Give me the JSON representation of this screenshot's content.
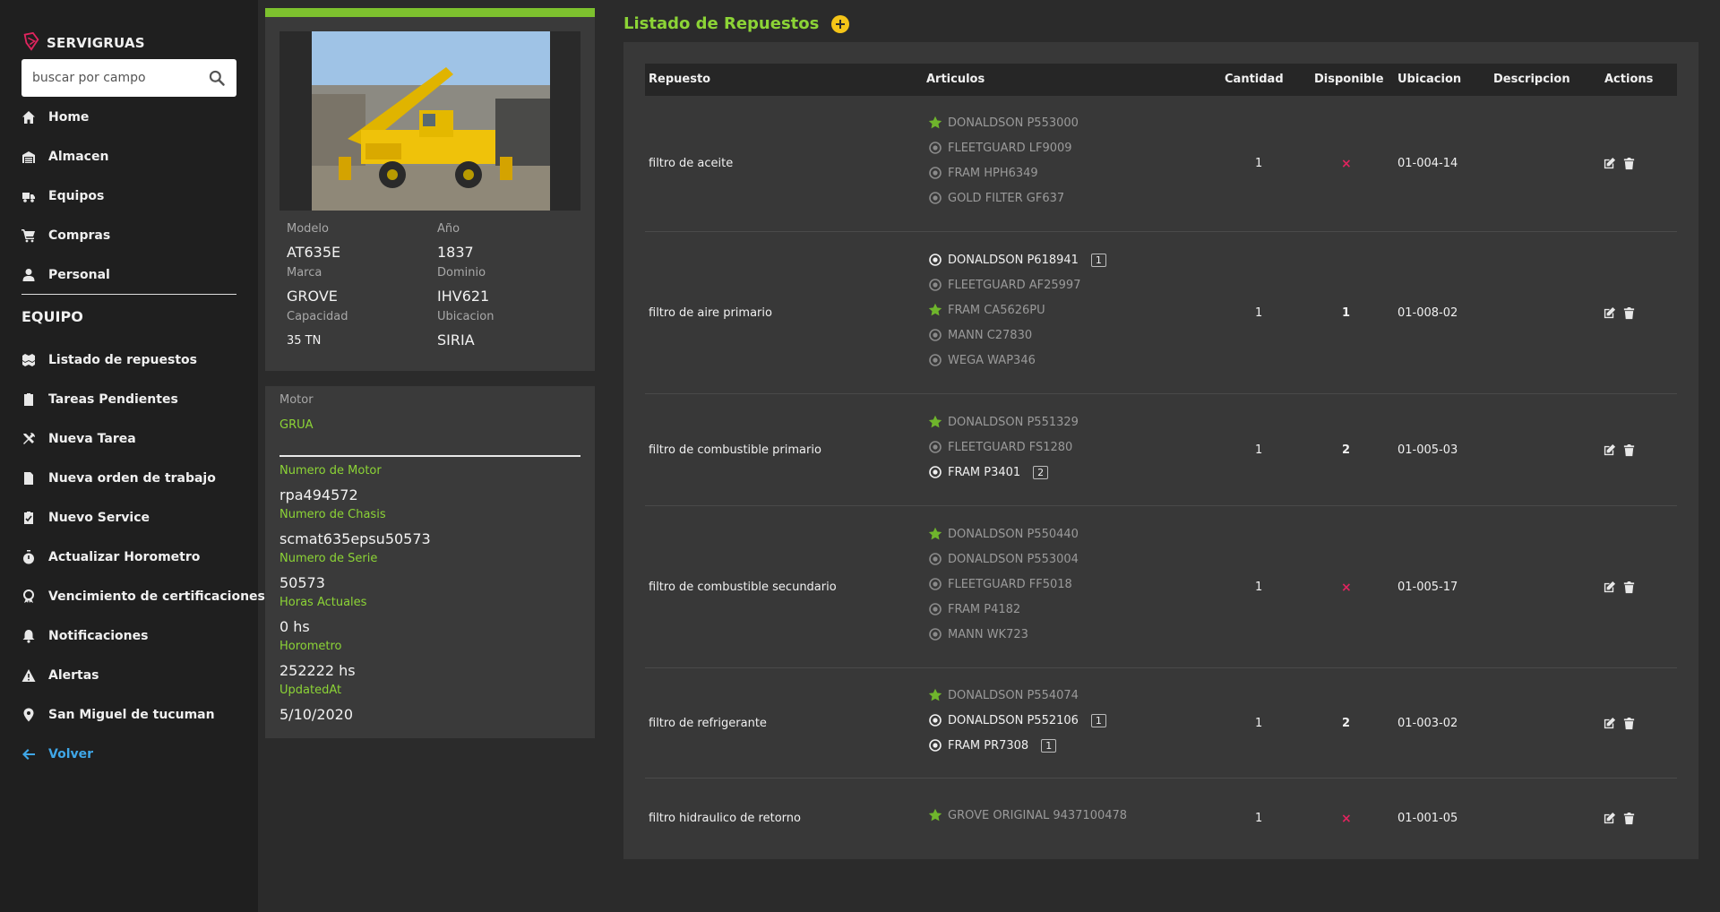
{
  "brand": {
    "name": "SERVIGRUAS"
  },
  "search": {
    "placeholder": "buscar por campo"
  },
  "nav_main": [
    {
      "label": "Home",
      "icon": "home-icon"
    },
    {
      "label": "Almacen",
      "icon": "warehouse-icon"
    },
    {
      "label": "Equipos",
      "icon": "truck-icon"
    },
    {
      "label": "Compras",
      "icon": "cart-icon"
    },
    {
      "label": "Personal",
      "icon": "user-icon"
    }
  ],
  "section_title": "EQUIPO",
  "nav_equipo": [
    {
      "label": "Listado de repuestos",
      "icon": "cubes-icon"
    },
    {
      "label": "Tareas Pendientes",
      "icon": "clipboard-icon"
    },
    {
      "label": "Nueva Tarea",
      "icon": "tools-icon"
    },
    {
      "label": "Nueva orden de trabajo",
      "icon": "file-icon"
    },
    {
      "label": "Nuevo Service",
      "icon": "clipboard-check-icon"
    },
    {
      "label": "Actualizar Horometro",
      "icon": "stopwatch-icon"
    },
    {
      "label": "Vencimiento de certificaciones",
      "icon": "award-icon"
    },
    {
      "label": "Notificaciones",
      "icon": "bell-icon"
    },
    {
      "label": "Alertas",
      "icon": "warning-icon"
    },
    {
      "label": "San Miguel de tucuman",
      "icon": "map-marker-icon"
    },
    {
      "label": "Volver",
      "icon": "arrow-left-icon"
    }
  ],
  "equipo": {
    "modelo_label": "Modelo",
    "modelo": "AT635E",
    "anio_label": "Año",
    "anio": "1837",
    "marca_label": "Marca",
    "marca": "GROVE",
    "dominio_label": "Dominio",
    "dominio": "IHV621",
    "capacidad_label": "Capacidad",
    "capacidad": "35 TN",
    "ubicacion_label": "Ubicacion",
    "ubicacion": "SIRIA"
  },
  "motor": {
    "label": "Motor",
    "tipo": "GRUA",
    "numero_motor_label": "Numero de Motor",
    "numero_motor": "rpa494572",
    "numero_chasis_label": "Numero de Chasis",
    "numero_chasis": "scmat635epsu50573",
    "numero_serie_label": "Numero de Serie",
    "numero_serie": "50573",
    "horas_label": "Horas Actuales",
    "horas": "0 hs",
    "horometro_label": "Horometro",
    "horometro": "252222 hs",
    "updated_label": "UpdatedAt",
    "updated": "5/10/2020"
  },
  "list": {
    "title": "Listado de Repuestos",
    "headers": [
      "Repuesto",
      "Articulos",
      "Cantidad",
      "Disponible",
      "Ubicacion",
      "Descripcion",
      "Actions"
    ],
    "rows": [
      {
        "repuesto": "filtro de aceite",
        "cantidad": "1",
        "disponible": "×",
        "ubicacion": "01-004-14",
        "descripcion": "",
        "articulos": [
          {
            "name": "DONALDSON P553000",
            "icon": "star-icon",
            "active": false,
            "badge": ""
          },
          {
            "name": "FLEETGUARD LF9009",
            "icon": "radio-icon",
            "active": false,
            "badge": ""
          },
          {
            "name": "FRAM HPH6349",
            "icon": "radio-icon",
            "active": false,
            "badge": ""
          },
          {
            "name": "GOLD FILTER GF637",
            "icon": "radio-icon",
            "active": false,
            "badge": ""
          }
        ]
      },
      {
        "repuesto": "filtro de aire primario",
        "cantidad": "1",
        "disponible": "1",
        "ubicacion": "01-008-02",
        "descripcion": "",
        "articulos": [
          {
            "name": "DONALDSON P618941",
            "icon": "radio-icon",
            "active": true,
            "badge": "1"
          },
          {
            "name": "FLEETGUARD AF25997",
            "icon": "radio-icon",
            "active": false,
            "badge": ""
          },
          {
            "name": "FRAM CA5626PU",
            "icon": "star-icon",
            "active": false,
            "badge": ""
          },
          {
            "name": "MANN C27830",
            "icon": "radio-icon",
            "active": false,
            "badge": ""
          },
          {
            "name": "WEGA WAP346",
            "icon": "radio-icon",
            "active": false,
            "badge": ""
          }
        ]
      },
      {
        "repuesto": "filtro de combustible primario",
        "cantidad": "1",
        "disponible": "2",
        "ubicacion": "01-005-03",
        "descripcion": "",
        "articulos": [
          {
            "name": "DONALDSON P551329",
            "icon": "star-icon",
            "active": false,
            "badge": ""
          },
          {
            "name": "FLEETGUARD FS1280",
            "icon": "radio-icon",
            "active": false,
            "badge": ""
          },
          {
            "name": "FRAM P3401",
            "icon": "radio-icon",
            "active": true,
            "badge": "2"
          }
        ]
      },
      {
        "repuesto": "filtro de combustible secundario",
        "cantidad": "1",
        "disponible": "×",
        "ubicacion": "01-005-17",
        "descripcion": "",
        "articulos": [
          {
            "name": "DONALDSON P550440",
            "icon": "star-icon",
            "active": false,
            "badge": ""
          },
          {
            "name": "DONALDSON P553004",
            "icon": "radio-icon",
            "active": false,
            "badge": ""
          },
          {
            "name": "FLEETGUARD FF5018",
            "icon": "radio-icon",
            "active": false,
            "badge": ""
          },
          {
            "name": "FRAM P4182",
            "icon": "radio-icon",
            "active": false,
            "badge": ""
          },
          {
            "name": "MANN WK723",
            "icon": "radio-icon",
            "active": false,
            "badge": ""
          }
        ]
      },
      {
        "repuesto": "filtro de refrigerante",
        "cantidad": "1",
        "disponible": "2",
        "ubicacion": "01-003-02",
        "descripcion": "",
        "articulos": [
          {
            "name": "DONALDSON P554074",
            "icon": "star-icon",
            "active": false,
            "badge": ""
          },
          {
            "name": "DONALDSON P552106",
            "icon": "radio-icon",
            "active": true,
            "badge": "1"
          },
          {
            "name": "FRAM PR7308",
            "icon": "radio-icon",
            "active": true,
            "badge": "1"
          }
        ]
      },
      {
        "repuesto": "filtro hidraulico de retorno",
        "cantidad": "1",
        "disponible": "×",
        "ubicacion": "01-001-05",
        "descripcion": "",
        "articulos": [
          {
            "name": "GROVE ORIGINAL 9437100478",
            "icon": "star-icon",
            "active": false,
            "badge": ""
          }
        ]
      }
    ]
  },
  "colors": {
    "accent_green": "#8cd436",
    "bar_green": "#7dc12e",
    "add_yellow": "#f5c518",
    "x_red": "#e0245e",
    "back_blue": "#3fa7e8"
  }
}
